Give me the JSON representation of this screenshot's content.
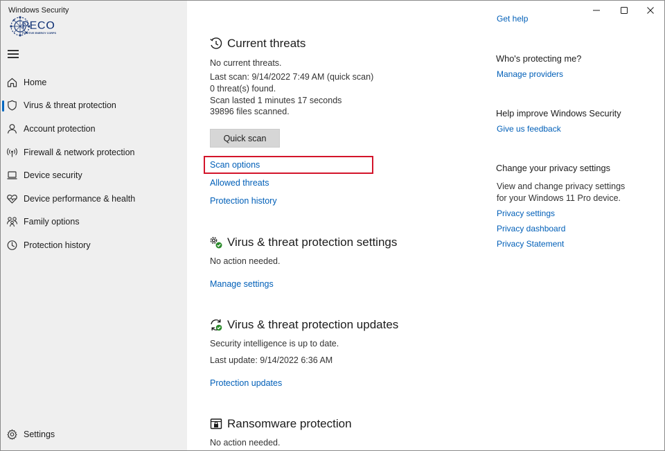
{
  "window": {
    "title": "Windows Security",
    "logo_text": "PECO",
    "logo_subtext": "POSITIVE ENERGY CORPS"
  },
  "sidebar": {
    "items": [
      {
        "label": "Home",
        "icon": "home-icon",
        "active": false
      },
      {
        "label": "Virus & threat protection",
        "icon": "shield-icon",
        "active": true
      },
      {
        "label": "Account protection",
        "icon": "person-icon",
        "active": false
      },
      {
        "label": "Firewall & network protection",
        "icon": "wireless-icon",
        "active": false
      },
      {
        "label": "Device security",
        "icon": "laptop-icon",
        "active": false
      },
      {
        "label": "Device performance & health",
        "icon": "heart-icon",
        "active": false
      },
      {
        "label": "Family options",
        "icon": "family-icon",
        "active": false
      },
      {
        "label": "Protection history",
        "icon": "history-icon",
        "active": false
      }
    ],
    "settings_label": "Settings"
  },
  "current_threats": {
    "heading": "Current threats",
    "status": "No current threats.",
    "last_scan": "Last scan: 9/14/2022 7:49 AM (quick scan)",
    "threats_found": "0 threat(s) found.",
    "scan_duration": "Scan lasted 1 minutes 17 seconds",
    "files_scanned": "39896 files scanned.",
    "quick_scan_button": "Quick scan",
    "scan_options_link": "Scan options",
    "allowed_threats_link": "Allowed threats",
    "protection_history_link": "Protection history"
  },
  "vtp_settings": {
    "heading": "Virus & threat protection settings",
    "status": "No action needed.",
    "manage_link": "Manage settings"
  },
  "vtp_updates": {
    "heading": "Virus & threat protection updates",
    "status": "Security intelligence is up to date.",
    "last_update": "Last update: 9/14/2022 6:36 AM",
    "updates_link": "Protection updates"
  },
  "ransomware": {
    "heading": "Ransomware protection",
    "status": "No action needed."
  },
  "right_panel": {
    "get_help_link": "Get help",
    "who_protecting_heading": "Who's protecting me?",
    "manage_providers_link": "Manage providers",
    "help_improve_heading": "Help improve Windows Security",
    "feedback_link": "Give us feedback",
    "privacy_heading": "Change your privacy settings",
    "privacy_line1": "View and change privacy settings",
    "privacy_line2": "for your Windows 11 Pro device.",
    "privacy_settings_link": "Privacy settings",
    "privacy_dashboard_link": "Privacy dashboard",
    "privacy_statement_link": "Privacy Statement"
  },
  "colors": {
    "sidebar_bg": "#efefef",
    "accent": "#0067c0",
    "link": "#005fb8",
    "highlight": "#d3142a",
    "button_bg": "#d6d6d6"
  }
}
